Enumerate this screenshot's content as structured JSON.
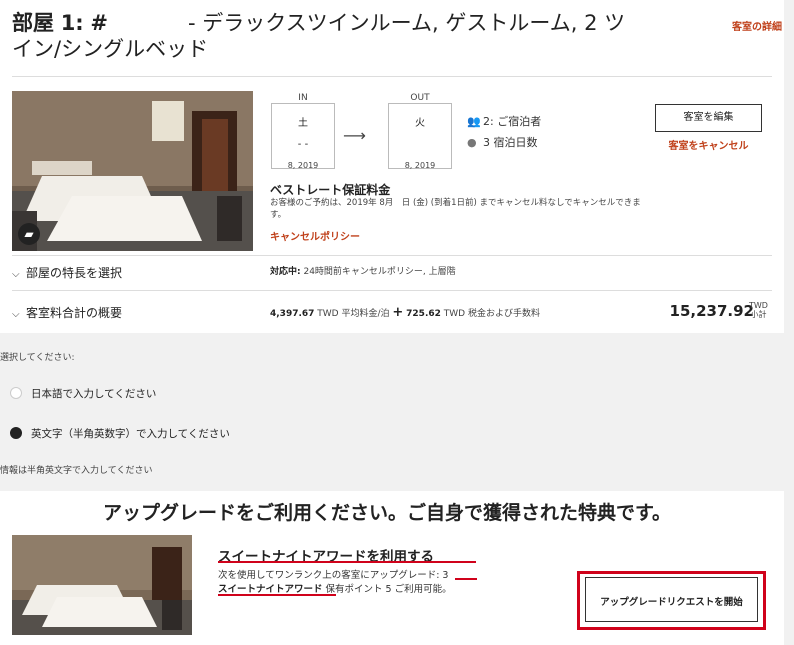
{
  "room": {
    "label": "部屋",
    "number": "1:",
    "hash": "#",
    "name_line1": "- デラックスツインルーム, ゲストルーム, 2 ツ",
    "name_line2": "イン/シングルベッド",
    "details_link": "客室の詳細"
  },
  "stay": {
    "in_label": "IN",
    "in_day": "土",
    "in_mid": "- -",
    "in_year": "8, 2019",
    "out_label": "OUT",
    "out_day": "火",
    "out_year": "8, 2019",
    "arrow": "⟶",
    "guests": "2: ご宿泊者",
    "nights": "3 宿泊日数"
  },
  "actions": {
    "edit_button": "客室を編集",
    "cancel_link": "客室をキャンセル"
  },
  "rate": {
    "title": "ベストレート保証料金",
    "desc": "お客様のご予約は、2019年 8月　日 (金) (到着1日前) までキャンセル料なしでキャンセルできます。",
    "policy_link": "キャンセルポリシー"
  },
  "features": {
    "label": "部屋の特長を選択",
    "cond_label": "対応中:",
    "cond_text": " 24時間前キャンセルポリシー, 上層階"
  },
  "summary": {
    "label": "客室料合計の概要",
    "avg_value": "4,397.67",
    "avg_text": " TWD 平均料金/泊 ",
    "plus": "+",
    "tax_value": "725.62",
    "tax_text": " TWD 税金および手数料",
    "total": "15,237.92",
    "total_currency": "TWD",
    "total_label": "小計"
  },
  "language": {
    "prompt": "選択してください:",
    "option_ja": "日本語で入力してください",
    "option_en": "英文字（半角英数字）で入力してください",
    "note": "情報は半角英文字で入力してください"
  },
  "upgrade": {
    "heading": "アップグレードをご利用ください。ご自身で獲得された特典です。",
    "award_title": "スイートナイトアワードを利用する",
    "desc_line1": "次を使用してワンランク上の客室にアップグレード: 3",
    "desc_line2_strong": "スイートナイトアワード",
    "desc_line2_rest": " 保有ポイント 5 ご利用可能。",
    "button": "アップグレードリクエストを開始"
  },
  "colors": {
    "accent": "#c0411b",
    "highlight": "#d0021b"
  }
}
